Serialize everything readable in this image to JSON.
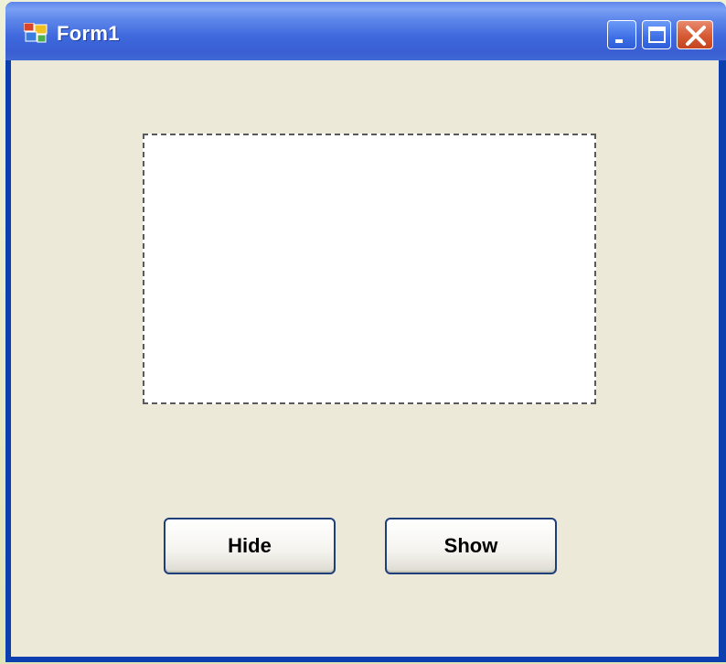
{
  "window": {
    "title": "Form1",
    "controls": {
      "minimize_icon": "minimize-icon",
      "maximize_icon": "maximize-icon",
      "close_icon": "close-icon"
    }
  },
  "form": {
    "hide_label": "Hide",
    "show_label": "Show"
  },
  "colors": {
    "titlebar": "#3e68dd",
    "client": "#ece9d8",
    "close": "#d65a33"
  }
}
